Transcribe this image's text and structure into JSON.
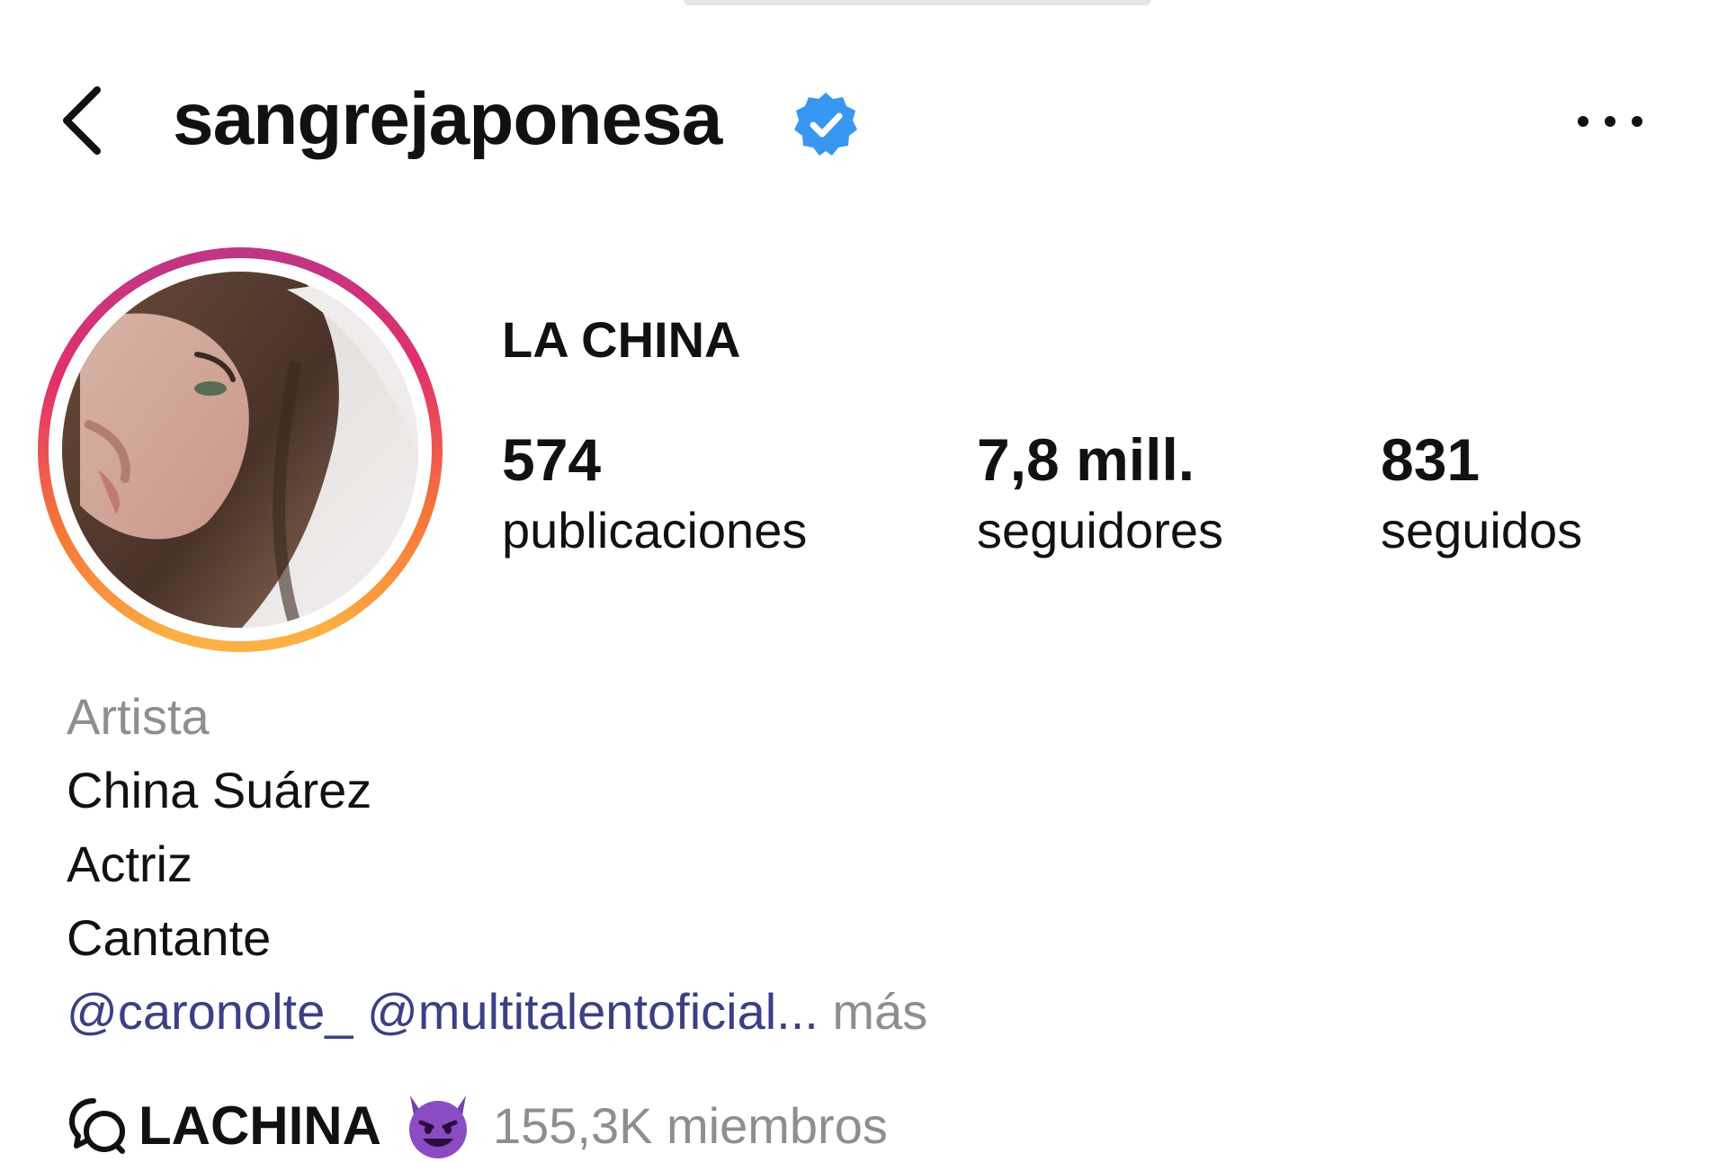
{
  "header": {
    "username": "sangrejaponesa",
    "back_icon": "chevron-left-icon",
    "verified_icon": "verified-badge-icon",
    "more_icon": "more-horizontal-icon",
    "verified_color": "#3897f0"
  },
  "profile": {
    "display_name": "LA CHINA",
    "avatar_alt": "profile photo",
    "story_ring_colors": [
      "#fcaf45",
      "#f77737",
      "#e1306c",
      "#c13584"
    ]
  },
  "stats": [
    {
      "value": "574",
      "label": "publicaciones"
    },
    {
      "value": "7,8 mill.",
      "label": "seguidores"
    },
    {
      "value": "831",
      "label": "seguidos"
    }
  ],
  "bio": {
    "category": "Artista",
    "lines": [
      "China Suárez",
      "Actriz",
      "Cantante"
    ],
    "mentions": [
      "@caronolte_",
      "@multitalentoficial..."
    ],
    "more_label": "más",
    "mention_color": "#3b3f86"
  },
  "channel": {
    "icon": "broadcast-channel-icon",
    "name": "LACHINA",
    "emoji": "smiling-devil-emoji",
    "members": "155,3K miembros"
  }
}
